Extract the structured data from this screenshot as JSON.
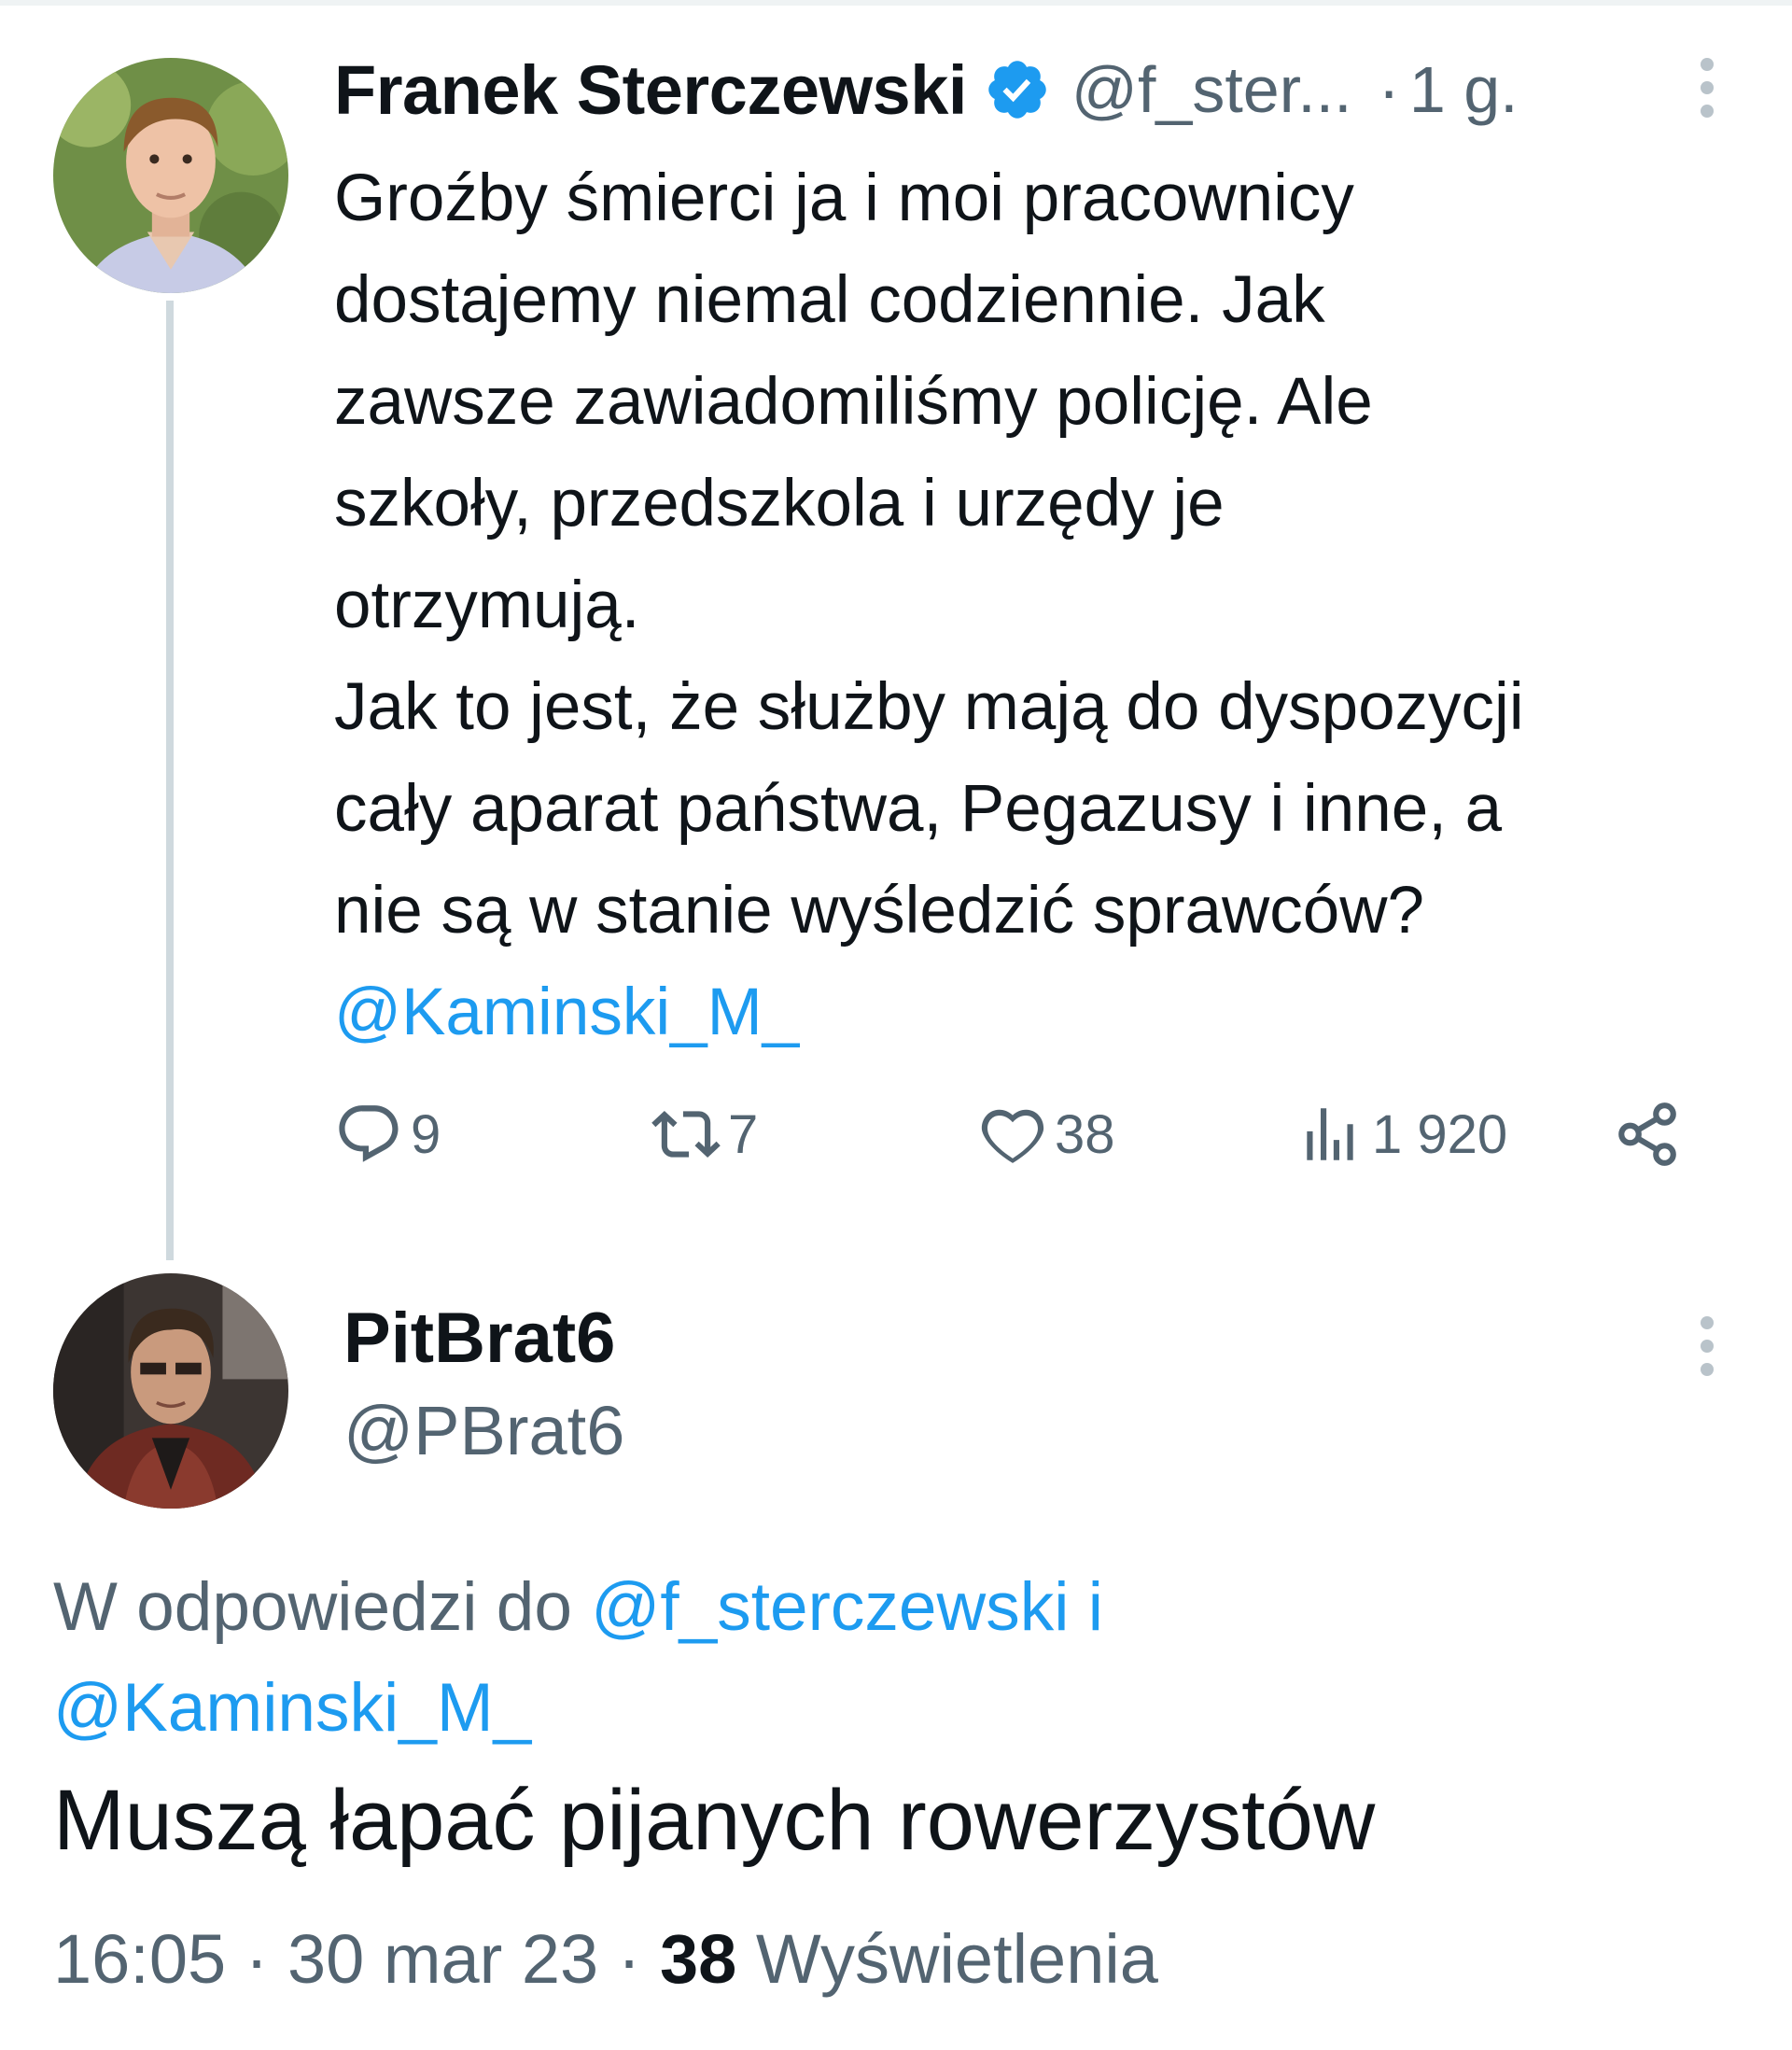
{
  "tweet": {
    "author_name": "Franek Sterczewski",
    "handle": "@f_ster...",
    "separator": "·",
    "time": "1 g.",
    "body_lines": [
      "Groźby śmierci ja i moi pracownicy",
      "dostajemy niemal codziennie. Jak",
      "zawsze zawiadomiliśmy policję. Ale",
      "szkoły, przedszkola i urzędy je",
      "otrzymują.",
      "Jak to jest, że służby mają do dyspozycji",
      "cały aparat państwa, Pegazusy i inne, a",
      "nie są w stanie wyśledzić sprawców?"
    ],
    "mention": "@Kaminski_M_",
    "replies": "9",
    "retweets": "7",
    "likes": "38",
    "views": "1 920"
  },
  "reply": {
    "author_name": "PitBrat6",
    "handle": "@PBrat6",
    "replying_prefix": "W odpowiedzi do",
    "replying_mention_1": "@f_sterczewski",
    "replying_conjunction": "i",
    "replying_mention_2": "@Kaminski_M_",
    "text": "Muszą łapać pijanych rowerzystów",
    "time": "16:05",
    "sep1": "·",
    "date": "30 mar 23",
    "sep2": "·",
    "views_count": "38",
    "views_label": "Wyświetlenia"
  },
  "colors": {
    "accent": "#1d9bf0",
    "text": "#0f1419",
    "secondary": "#536471",
    "thread_line": "#cfd9de"
  },
  "icons": [
    "more-vertical-icon",
    "verified-badge-icon",
    "reply-icon",
    "retweet-icon",
    "like-icon",
    "views-icon",
    "share-icon"
  ]
}
